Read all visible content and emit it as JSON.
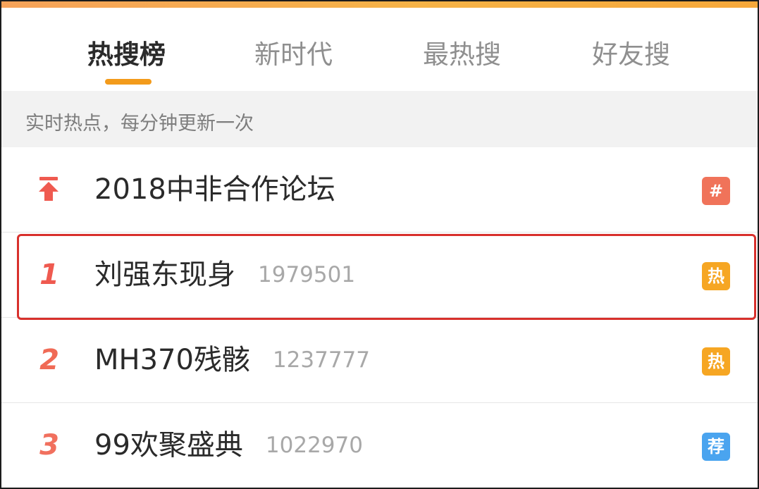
{
  "tabs": [
    {
      "label": "热搜榜",
      "active": true
    },
    {
      "label": "新时代",
      "active": false
    },
    {
      "label": "最热搜",
      "active": false
    },
    {
      "label": "好友搜",
      "active": false
    }
  ],
  "subheader": {
    "text": "实时热点，每分钟更新一次"
  },
  "items": [
    {
      "rank": "",
      "rank_icon": "pin-top-icon",
      "title": "2018中非合作论坛",
      "count": "",
      "badge": "#",
      "badge_type": "topic"
    },
    {
      "rank": "1",
      "title": "刘强东现身",
      "count": "1979501",
      "badge": "热",
      "badge_type": "hot"
    },
    {
      "rank": "2",
      "title": "MH370残骸",
      "count": "1237777",
      "badge": "热",
      "badge_type": "hot"
    },
    {
      "rank": "3",
      "title": "99欢聚盛典",
      "count": "1022970",
      "badge": "荐",
      "badge_type": "recommend"
    }
  ],
  "colors": {
    "accent": "#f39b1b",
    "highlight": "#d8302c",
    "badge_topic": "#f0735a",
    "badge_hot": "#f6a623",
    "badge_recommend": "#4aa4ef"
  }
}
